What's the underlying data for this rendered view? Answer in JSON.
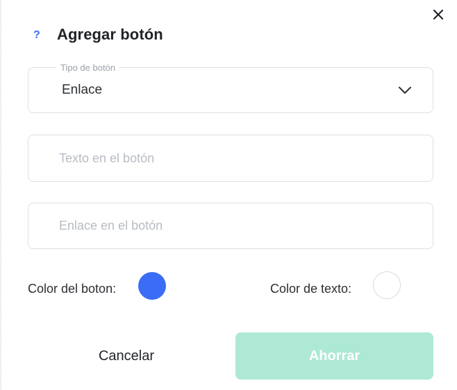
{
  "dialog": {
    "title": "Agregar botón",
    "help_glyph": "?",
    "close_glyph": "×"
  },
  "button_type": {
    "legend": "Tipo de botón",
    "value": "Enlace"
  },
  "button_text": {
    "value": "",
    "placeholder": "Texto en el botón"
  },
  "button_link": {
    "value": "",
    "placeholder": "Enlace en el botón"
  },
  "colors": {
    "button_label": "Color del boton:",
    "button_color": "#3b6cf6",
    "text_label": "Color de texto:",
    "text_color": "#ffffff"
  },
  "actions": {
    "cancel_label": "Cancelar",
    "save_label": "Ahorrar",
    "save_color": "#ade9d4",
    "save_disabled": true
  }
}
